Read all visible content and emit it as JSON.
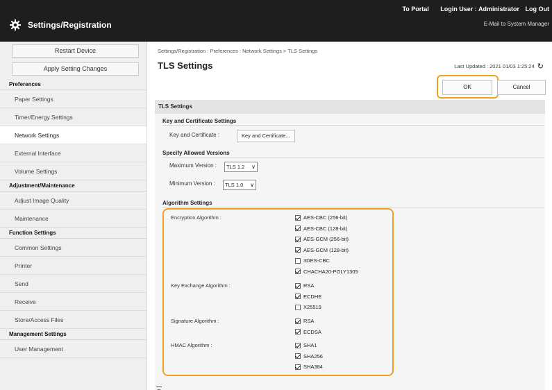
{
  "header": {
    "app_title": "Settings/Registration",
    "to_portal": "To Portal",
    "login_user": "Login User : Administrator",
    "logout": "Log Out",
    "mail_link": "E-Mail to System Manager"
  },
  "sidebar": {
    "restart_label": "Restart Device",
    "apply_label": "Apply Setting Changes",
    "preferences": {
      "title": "Preferences",
      "items": [
        "Paper Settings",
        "Timer/Energy Settings",
        "Network Settings",
        "External Interface",
        "Volume Settings"
      ]
    },
    "adjustment": {
      "title": "Adjustment/Maintenance",
      "items": [
        "Adjust Image Quality",
        "Maintenance"
      ]
    },
    "function": {
      "title": "Function Settings",
      "items": [
        "Common Settings",
        "Printer",
        "Send",
        "Receive",
        "Store/Access Files"
      ]
    },
    "management": {
      "title": "Management Settings",
      "items": [
        "User Management"
      ]
    }
  },
  "main": {
    "breadcrumb": "Settings/Registration : Preferences : Network Settings > TLS Settings",
    "page_title": "TLS Settings",
    "last_updated": "Last Updated : 2021 01/03 1:25:24",
    "ok_label": "OK",
    "cancel_label": "Cancel",
    "section_title": "TLS Settings",
    "key_cert": {
      "heading": "Key and Certificate Settings",
      "label": "Key and Certificate :",
      "button": "Key and Certificate..."
    },
    "versions": {
      "heading": "Specify Allowed Versions",
      "max_label": "Maximum Version :",
      "max_value": "TLS 1.2",
      "min_label": "Minimum Version :",
      "min_value": "TLS 1.0"
    },
    "algorithm": {
      "heading": "Algorithm Settings",
      "encryption_label": "Encryption Algorithm :",
      "encryption": [
        {
          "label": "AES-CBC (256-bit)",
          "checked": true
        },
        {
          "label": "AES-CBC (128-bit)",
          "checked": true
        },
        {
          "label": "AES-GCM (256-bit)",
          "checked": true
        },
        {
          "label": "AES-GCM (128-bit)",
          "checked": true
        },
        {
          "label": "3DES-CBC",
          "checked": false
        },
        {
          "label": "CHACHA20-POLY1305",
          "checked": true
        }
      ],
      "key_exchange_label": "Key Exchange Algorithm :",
      "key_exchange": [
        {
          "label": "RSA",
          "checked": true
        },
        {
          "label": "ECDHE",
          "checked": true
        },
        {
          "label": "X25519",
          "checked": false
        }
      ],
      "signature_label": "Signature Algorithm :",
      "signature": [
        {
          "label": "RSA",
          "checked": true
        },
        {
          "label": "ECDSA",
          "checked": true
        }
      ],
      "hmac_label": "HMAC Algorithm :",
      "hmac": [
        {
          "label": "SHA1",
          "checked": true
        },
        {
          "label": "SHA256",
          "checked": true
        },
        {
          "label": "SHA384",
          "checked": true
        }
      ]
    }
  },
  "colors": {
    "header_bg": "#1e1e1e",
    "sidebar_bg": "#efefef",
    "highlight": "#f0a020"
  }
}
